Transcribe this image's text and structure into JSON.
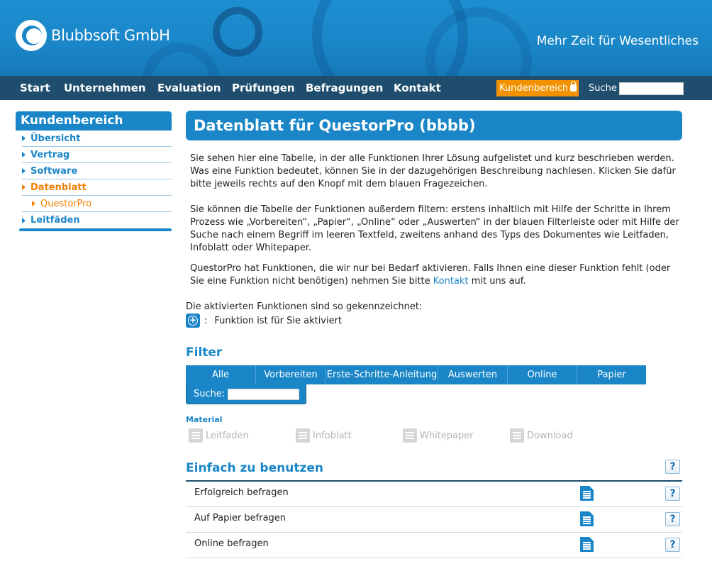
{
  "header": {
    "brand": "Blubbsoft GmbH",
    "slogan": "Mehr Zeit für Wesentliches"
  },
  "nav": {
    "items": [
      "Start",
      "Unternehmen",
      "Evaluation",
      "Prüfungen",
      "Befragungen",
      "Kontakt"
    ],
    "customer_area": "Kundenbereich",
    "search_label": "Suche",
    "search_value": ""
  },
  "sidebar": {
    "title": "Kundenbereich",
    "items": [
      {
        "label": "Übersicht"
      },
      {
        "label": "Vertrag"
      },
      {
        "label": "Software"
      },
      {
        "label": "Datenblatt"
      },
      {
        "label": "QuestorPro"
      },
      {
        "label": "Leitfäden"
      }
    ]
  },
  "main": {
    "title": "Datenblatt für QuestorPro (bbbb)",
    "para1": "Sie sehen hier eine Tabelle, in der alle Funktionen Ihrer Lösung aufgelistet und kurz beschrieben werden. Was eine Funktion bedeutet, können Sie in der dazugehörigen Beschreibung nachlesen. Klicken Sie dafür bitte jeweils rechts auf den Knopf mit dem blauen Fragezeichen.",
    "para2": "Sie können die Tabelle der Funktionen außerdem filtern: erstens inhaltlich mit Hilfe der Schritte in Ihrem Prozess wie „Vorbereiten“, „Papier“, „Online“ oder „Auswerten“ in der blauen Filterleiste oder mit Hilfe der Suche nach einem Begriff im leeren Textfeld, zweitens anhand des Typs des Dokumentes wie Leitfaden, Infoblatt oder Whitepaper.",
    "para3_before": "QuestorPro hat Funktionen, die wir nur bei Bedarf aktivieren. Falls Ihnen eine dieser Funktion fehlt (oder Sie eine Funktion nicht benötigen) nehmen Sie bitte ",
    "para3_link": "Kontakt",
    "para3_after": " mit uns auf.",
    "activated_label": "Die aktivierten Funktionen sind so gekennzeichnet:",
    "activated_sep": ":",
    "activated_text": "Funktion ist für Sie aktiviert"
  },
  "filter": {
    "title": "Filter",
    "buttons": [
      "Alle",
      "Vorbereiten",
      "Erste-Schritte-Anleitung",
      "Auswerten",
      "Online",
      "Papier"
    ],
    "search_label": "Suche:",
    "search_value": ""
  },
  "material": {
    "title": "Material",
    "items": [
      "Leitfaden",
      "Infoblatt",
      "Whitepaper",
      "Download"
    ]
  },
  "section": {
    "title": "Einfach zu benutzen",
    "help": "?",
    "rows": [
      {
        "label": "Erfolgreich befragen",
        "help": "?"
      },
      {
        "label": "Auf Papier befragen",
        "help": "?"
      },
      {
        "label": "Online befragen",
        "help": "?"
      }
    ]
  },
  "colors": {
    "primary": "#1a86c8",
    "nav": "#1e4d6e",
    "accent": "#f39200"
  }
}
